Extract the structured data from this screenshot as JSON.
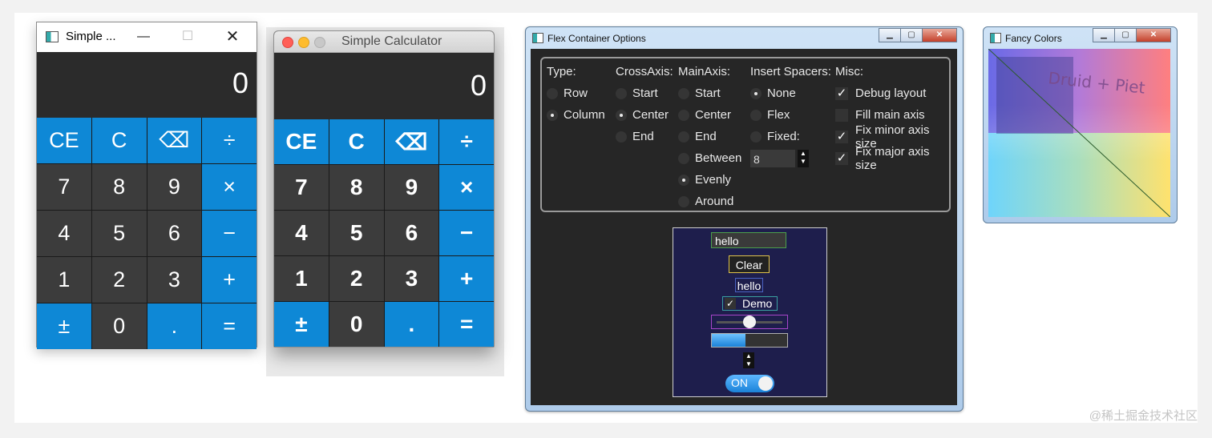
{
  "win_calc": {
    "title": "Simple ...",
    "min": "—",
    "max": "☐",
    "close": "✕",
    "display": "0",
    "keys": [
      {
        "label": "CE",
        "style": "blue"
      },
      {
        "label": "C",
        "style": "blue"
      },
      {
        "label": "⌫",
        "style": "blue"
      },
      {
        "label": "÷",
        "style": "blue"
      },
      {
        "label": "7",
        "style": "dark"
      },
      {
        "label": "8",
        "style": "dark"
      },
      {
        "label": "9",
        "style": "dark"
      },
      {
        "label": "×",
        "style": "blue"
      },
      {
        "label": "4",
        "style": "dark"
      },
      {
        "label": "5",
        "style": "dark"
      },
      {
        "label": "6",
        "style": "dark"
      },
      {
        "label": "−",
        "style": "blue"
      },
      {
        "label": "1",
        "style": "dark"
      },
      {
        "label": "2",
        "style": "dark"
      },
      {
        "label": "3",
        "style": "dark"
      },
      {
        "label": "+",
        "style": "blue"
      },
      {
        "label": "±",
        "style": "blue"
      },
      {
        "label": "0",
        "style": "dark"
      },
      {
        "label": ".",
        "style": "blue"
      },
      {
        "label": "=",
        "style": "blue"
      }
    ]
  },
  "mac_calc": {
    "title": "Simple Calculator",
    "display": "0",
    "keys": [
      {
        "label": "CE",
        "style": "blue"
      },
      {
        "label": "C",
        "style": "blue"
      },
      {
        "label": "⌫",
        "style": "blue"
      },
      {
        "label": "÷",
        "style": "blue"
      },
      {
        "label": "7",
        "style": "dark"
      },
      {
        "label": "8",
        "style": "dark"
      },
      {
        "label": "9",
        "style": "dark"
      },
      {
        "label": "×",
        "style": "blue"
      },
      {
        "label": "4",
        "style": "dark"
      },
      {
        "label": "5",
        "style": "dark"
      },
      {
        "label": "6",
        "style": "dark"
      },
      {
        "label": "−",
        "style": "blue"
      },
      {
        "label": "1",
        "style": "dark"
      },
      {
        "label": "2",
        "style": "dark"
      },
      {
        "label": "3",
        "style": "dark"
      },
      {
        "label": "+",
        "style": "blue"
      },
      {
        "label": "±",
        "style": "blue"
      },
      {
        "label": "0",
        "style": "dark"
      },
      {
        "label": ".",
        "style": "blue"
      },
      {
        "label": "=",
        "style": "blue"
      }
    ]
  },
  "flex": {
    "title": "Flex Container Options",
    "type": {
      "header": "Type:",
      "options": [
        {
          "label": "Row",
          "selected": false
        },
        {
          "label": "Column",
          "selected": true
        }
      ]
    },
    "cross": {
      "header": "CrossAxis:",
      "options": [
        {
          "label": "Start",
          "selected": false
        },
        {
          "label": "Center",
          "selected": true
        },
        {
          "label": "End",
          "selected": false
        }
      ]
    },
    "main": {
      "header": "MainAxis:",
      "options": [
        {
          "label": "Start",
          "selected": false
        },
        {
          "label": "Center",
          "selected": false
        },
        {
          "label": "End",
          "selected": false
        },
        {
          "label": "Between",
          "selected": false
        },
        {
          "label": "Evenly",
          "selected": true
        },
        {
          "label": "Around",
          "selected": false
        }
      ]
    },
    "spacers": {
      "header": "Insert Spacers:",
      "options": [
        {
          "label": "None",
          "selected": true
        },
        {
          "label": "Flex",
          "selected": false
        },
        {
          "label": "Fixed:",
          "selected": false
        }
      ],
      "fixed_value": "8"
    },
    "misc": {
      "header": "Misc:",
      "options": [
        {
          "label": "Debug layout",
          "checked": true
        },
        {
          "label": "Fill main axis",
          "checked": false
        },
        {
          "label": "Fix minor axis size",
          "checked": true
        },
        {
          "label": "Fix major axis size",
          "checked": true
        }
      ]
    },
    "demo": {
      "textbox_value": "hello",
      "button_label": "Clear",
      "label_text": "hello",
      "checkbox_label": "Demo",
      "checkbox_checked": true,
      "slider_value": 0.5,
      "progress_value": 0.45,
      "switch_label": "ON"
    }
  },
  "fancy": {
    "title": "Fancy Colors",
    "canvas_text": "Druid + Piet"
  },
  "watermark": "@稀土掘金技术社区"
}
